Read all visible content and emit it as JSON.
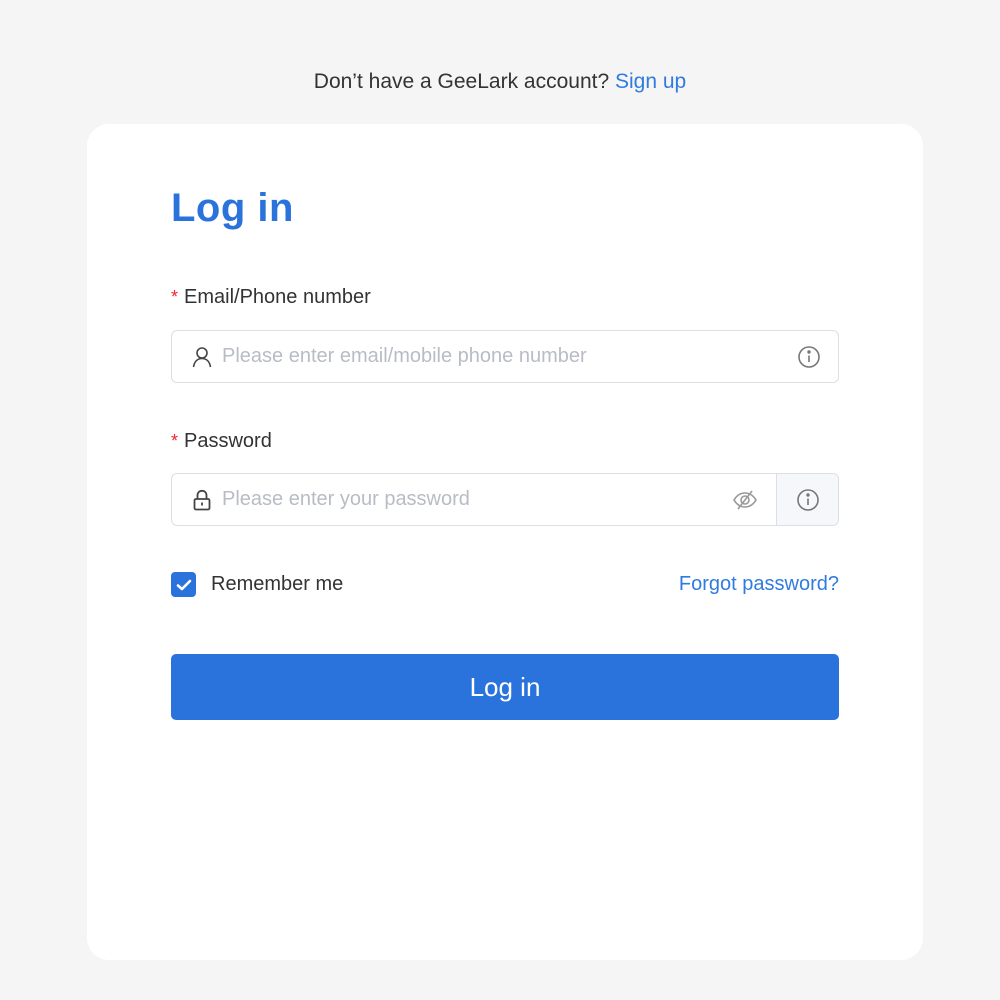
{
  "header": {
    "prompt_text": "Don’t have a GeeLark account?",
    "signup_link": "Sign up"
  },
  "form": {
    "title": "Log in",
    "email": {
      "required_mark": "*",
      "label": "Email/Phone number",
      "placeholder": "Please enter email/mobile phone number",
      "value": "",
      "lead_icon": "user-icon",
      "trail_icon": "info-icon"
    },
    "password": {
      "required_mark": "*",
      "label": "Password",
      "placeholder": "Please enter your password",
      "value": "",
      "lead_icon": "lock-icon",
      "toggle_icon": "eye-off-icon",
      "addon_icon": "info-icon"
    },
    "remember_me": {
      "label": "Remember me",
      "checked": true
    },
    "forgot_password": "Forgot password?",
    "submit_label": "Log in"
  },
  "colors": {
    "accent": "#2a73dd",
    "link": "#2f7be0",
    "required": "#f5222d",
    "page_background": "#f5f5f5",
    "card_background": "#ffffff"
  }
}
